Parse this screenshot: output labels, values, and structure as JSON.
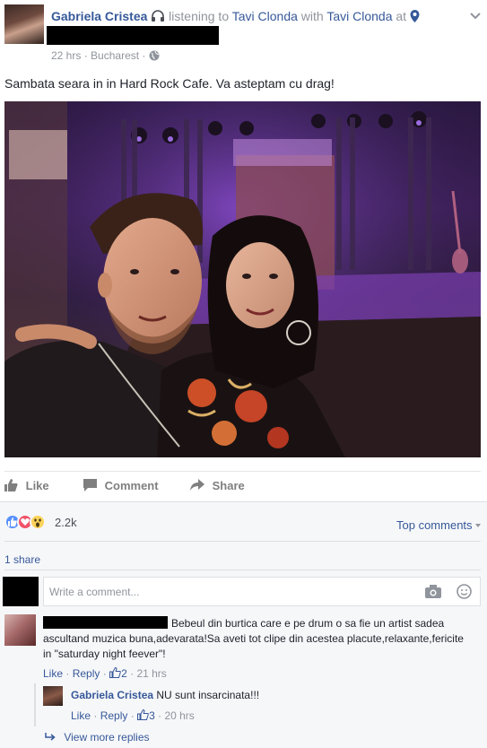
{
  "post": {
    "author": "Gabriela Cristea",
    "activity_prefix": "listening to",
    "song": "Tavi Clonda",
    "with_text": "with",
    "with_person": "Tavi Clonda",
    "at_text": "at",
    "time": "22 hrs",
    "location": "Bucharest",
    "separator": "·",
    "text": "Sambata seara in in Hard Rock Cafe. Va asteptam cu drag!",
    "photo_alt": "Selfie of a man and a woman at Hard Rock Cafe Bucharest, purple-lit stage behind them"
  },
  "actions": {
    "like": "Like",
    "comment": "Comment",
    "share": "Share"
  },
  "reactions": {
    "count": "2.2k",
    "top_comments": "Top comments",
    "shares": "1 share"
  },
  "composer": {
    "placeholder": "Write a comment..."
  },
  "comments": [
    {
      "text": "Bebeul din burtica care e pe drum o sa fie un artist sadea ascultand muzica buna,adevarata!Sa aveti tot clipe din acestea placute,relaxante,fericite in \"saturday night feever\"!",
      "like": "Like",
      "reply": "Reply",
      "likes": "2",
      "time": "21 hrs"
    }
  ],
  "reply": {
    "author": "Gabriela Cristea",
    "text": "NU sunt insarcinata!!!",
    "like": "Like",
    "reply": "Reply",
    "likes": "3",
    "time": "20 hrs"
  },
  "more_replies": "View more replies",
  "colors": {
    "link": "#365899",
    "grey": "#90949c",
    "like_blue": "#5890ff",
    "love_red": "#f25268",
    "wow_yellow": "#fcd35b"
  }
}
